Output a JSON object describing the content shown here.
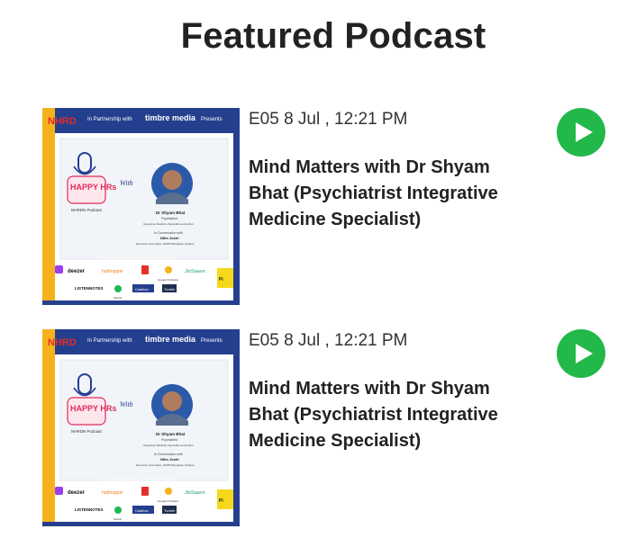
{
  "header": {
    "title": "Featured Podcast"
  },
  "colors": {
    "play_button": "#22b84a",
    "cover_frame": "#253f8f",
    "cover_accent": "#f5b21c"
  },
  "episodes": [
    {
      "meta": "E05 8 Jul , 12:21 PM",
      "title": "Mind Matters with Dr Shyam Bhat (Psychiatrist Integrative Medicine Specialist)",
      "play_icon": "play-icon",
      "cover": {
        "brand": "NHRD",
        "partner_text": "In Partnership with",
        "partner_brand": "timbre media",
        "presents": "Presents",
        "show_name": "HAPPY HRs",
        "show_sub": "NHRDN Podcast",
        "with": "With",
        "guest_name": "Dr Shyam Bhat",
        "guest_role": "Psychiatrist",
        "guest_role2": "Integrative Medicine Specialist and Author",
        "conversation": "In Conversation with",
        "host_name": "Nitin Joshi",
        "host_role": "Executive Committee, NHRD Bangalore Chapter",
        "tune_in": "Tune into #HappyHRs on Following Channels",
        "channels": [
          "deezer",
          "hubhopper",
          "Google Podcasts",
          "JioSaavn",
          "LISTENNOTES",
          "Spotify",
          "Castbox",
          "TuneIn"
        ]
      }
    },
    {
      "meta": "E05 8 Jul , 12:21 PM",
      "title": "Mind Matters with Dr Shyam Bhat (Psychiatrist Integrative Medicine Specialist)",
      "play_icon": "play-icon",
      "cover": {
        "brand": "NHRD",
        "partner_text": "In Partnership with",
        "partner_brand": "timbre media",
        "presents": "Presents",
        "show_name": "HAPPY HRs",
        "show_sub": "NHRDN Podcast",
        "with": "With",
        "guest_name": "Dr Shyam Bhat",
        "guest_role": "Psychiatrist",
        "guest_role2": "Integrative Medicine Specialist and Author",
        "conversation": "In Conversation with",
        "host_name": "Nitin Joshi",
        "host_role": "Executive Committee, NHRD Bangalore Chapter",
        "tune_in": "Tune into #HappyHRs on Following Channels",
        "channels": [
          "deezer",
          "hubhopper",
          "Google Podcasts",
          "JioSaavn",
          "LISTENNOTES",
          "Spotify",
          "Castbox",
          "TuneIn"
        ]
      }
    }
  ]
}
